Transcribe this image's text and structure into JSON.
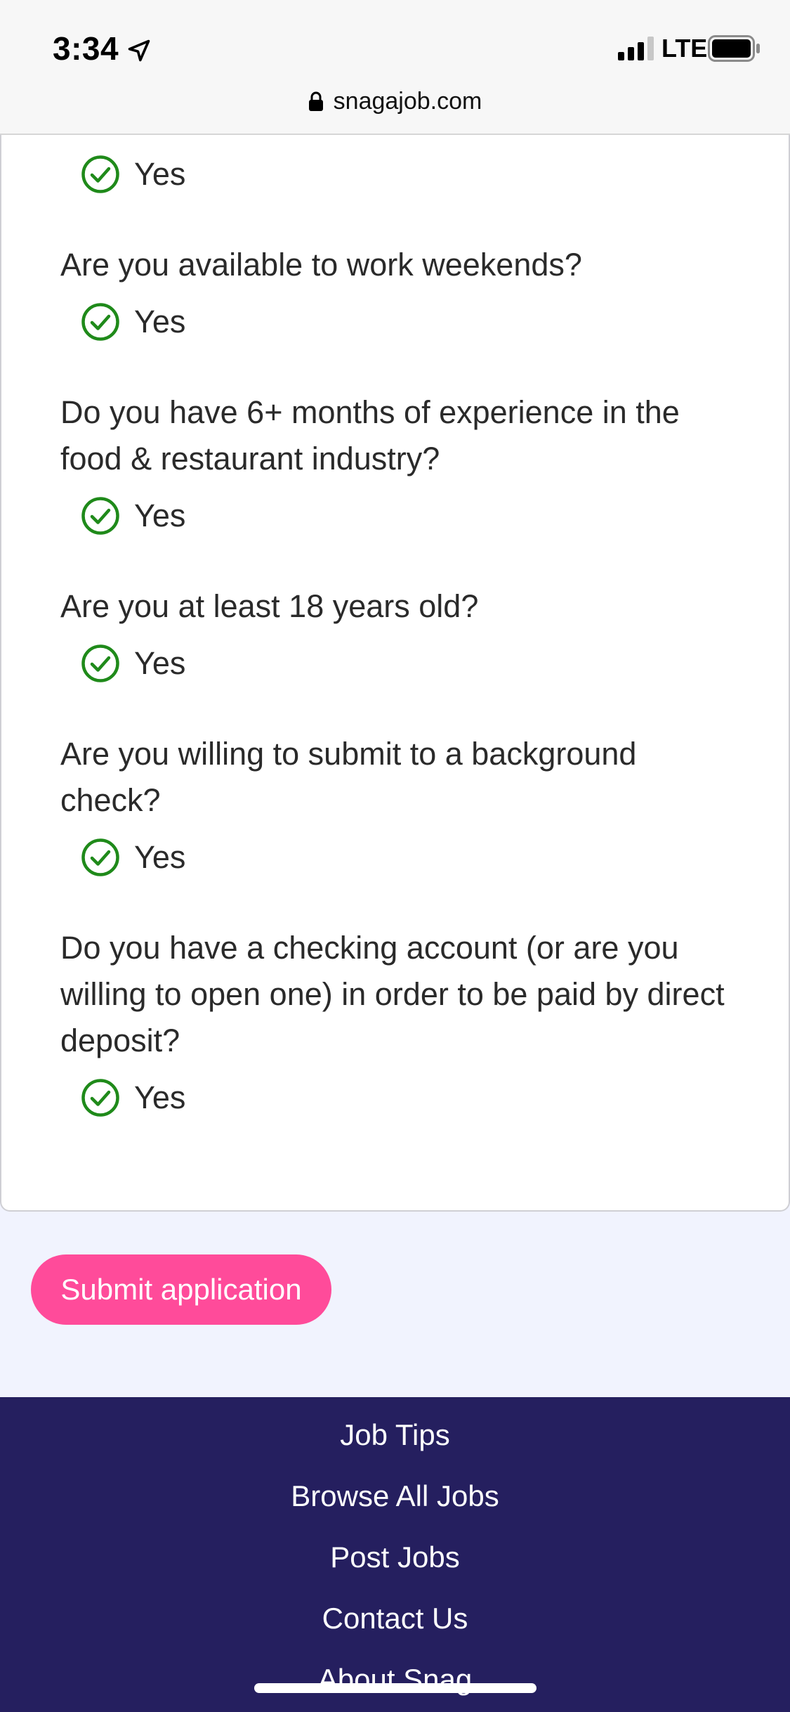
{
  "status_bar": {
    "time": "3:34",
    "carrier": "LTE",
    "url": "snagajob.com"
  },
  "questions": [
    {
      "question": "",
      "answer": "Yes"
    },
    {
      "question": "Are you available to work weekends?",
      "answer": "Yes"
    },
    {
      "question": "Do you have 6+ months of experience in the food & restaurant industry?",
      "answer": "Yes"
    },
    {
      "question": "Are you at least 18 years old?",
      "answer": "Yes"
    },
    {
      "question": "Are you willing to submit to a background check?",
      "answer": "Yes"
    },
    {
      "question": "Do you have a checking account (or are you willing to open one) in order to be paid by direct deposit?",
      "answer": "Yes"
    }
  ],
  "submit": {
    "label": "Submit application"
  },
  "footer": {
    "links": [
      "Job Tips",
      "Browse All Jobs",
      "Post Jobs",
      "Contact Us",
      "About Snag"
    ]
  },
  "colors": {
    "accent": "#ff4b9a",
    "footer_bg": "#251f5f",
    "check": "#1f8a1a",
    "page_bg": "#f1f3fe"
  },
  "icons": [
    "location-arrow-icon",
    "signal-icon",
    "battery-icon",
    "lock-icon",
    "check-circle-icon"
  ]
}
